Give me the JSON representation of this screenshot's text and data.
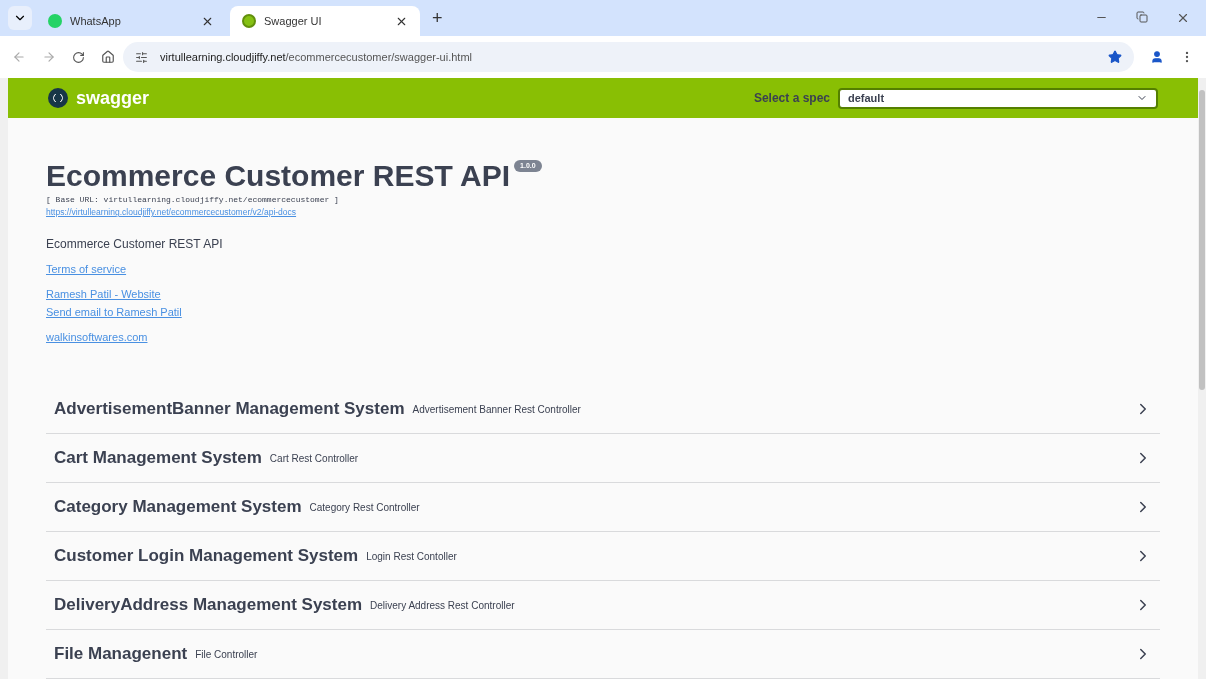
{
  "browser": {
    "tabs": [
      {
        "title": "WhatsApp",
        "kind": "whatsapp",
        "selected": false
      },
      {
        "title": "Swagger UI",
        "kind": "swagger",
        "selected": true
      }
    ],
    "new_tab": "+",
    "url_host": "virtullearning.cloudjiffy.net",
    "url_path": "/ecommercecustomer/swagger-ui.html"
  },
  "topbar": {
    "logo": "swagger",
    "spec_label": "Select a spec",
    "spec_value": "default"
  },
  "info": {
    "title": "Ecommerce Customer REST API",
    "version": "1.0.0",
    "base_url": "[ Base URL: virtullearning.cloudjiffy.net/ecommercecustomer ]",
    "docs_link": "https://virtullearning.cloudjiffy.net/ecommercecustomer/v2/api-docs",
    "description": "Ecommerce Customer REST API",
    "link_groups": [
      [
        "Terms of service"
      ],
      [
        "Ramesh Patil - Website",
        "Send email to Ramesh Patil"
      ],
      [
        "walkinsoftwares.com"
      ]
    ]
  },
  "sections": [
    {
      "name": "AdvertisementBanner Management System",
      "description": "Advertisement Banner Rest Controller",
      "expanded": false
    },
    {
      "name": "Cart Management System",
      "description": "Cart Rest Controller",
      "expanded": false
    },
    {
      "name": "Category Management System",
      "description": "Category Rest Controller",
      "expanded": false
    },
    {
      "name": "Customer Login Management System",
      "description": "Login Rest Contoller",
      "expanded": false
    },
    {
      "name": "DeliveryAddress Management System",
      "description": "Delivery Address Rest Controller",
      "expanded": false
    },
    {
      "name": "File Managenent",
      "description": "File Controller",
      "expanded": false
    }
  ]
}
